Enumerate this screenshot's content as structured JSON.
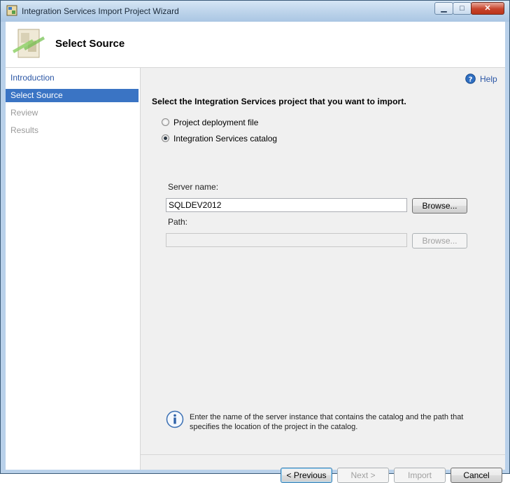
{
  "window": {
    "title": "Integration Services Import Project Wizard",
    "controls": {
      "minimize": "▁",
      "maximize": "□",
      "close": "✕"
    }
  },
  "banner": {
    "title": "Select Source",
    "icon": "wizard-page-icon"
  },
  "nav": {
    "items": [
      {
        "label": "Introduction",
        "state": "link"
      },
      {
        "label": "Select Source",
        "state": "selected"
      },
      {
        "label": "Review",
        "state": "disabled"
      },
      {
        "label": "Results",
        "state": "disabled"
      }
    ]
  },
  "help": {
    "label": "Help",
    "icon": "help-icon"
  },
  "instruction": "Select the Integration Services project that you want to import.",
  "options": [
    {
      "label": "Project deployment file",
      "checked": false
    },
    {
      "label": "Integration Services catalog",
      "checked": true
    }
  ],
  "server": {
    "label": "Server name:",
    "value": "SQLDEV2012",
    "browse": "Browse..."
  },
  "path": {
    "label": "Path:",
    "value": "",
    "browse": "Browse..."
  },
  "info": {
    "icon": "info-icon",
    "text": "Enter the name of the server instance that contains the catalog and the path that specifies the location of the project in the catalog."
  },
  "buttons": {
    "previous": "< Previous",
    "next": "Next >",
    "import": "Import",
    "cancel": "Cancel"
  },
  "colors": {
    "selection": "#3a74c4",
    "link": "#2b56a5",
    "panel": "#f0f0f0"
  }
}
